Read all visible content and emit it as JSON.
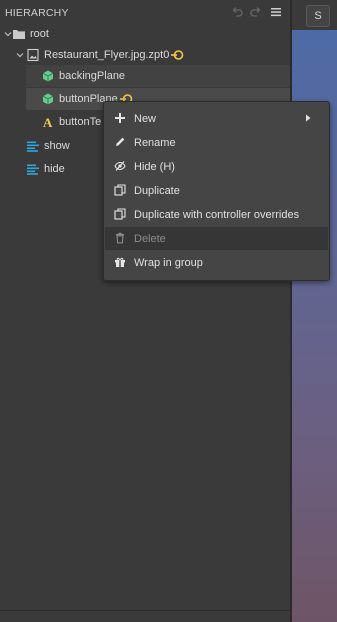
{
  "panel": {
    "title": "HIERARCHY"
  },
  "tree": {
    "root": "root",
    "file": "Restaurant_Flyer.jpg.zpt0",
    "backing_plane": "backingPlane",
    "button_plane": "buttonPlane",
    "button_text": "buttonTe",
    "show": "show",
    "hide": "hide"
  },
  "viewport": {
    "s_button": "S"
  },
  "context_menu": {
    "new": "New",
    "rename": "Rename",
    "hide": "Hide (H)",
    "duplicate": "Duplicate",
    "duplicate_overrides": "Duplicate with controller overrides",
    "delete": "Delete",
    "wrap": "Wrap in group"
  },
  "colors": {
    "link_accent": "#f2c94c",
    "plane_icon": "#5fd18a",
    "text_icon": "#f2c94c",
    "action_icon": "#29a8e0"
  }
}
